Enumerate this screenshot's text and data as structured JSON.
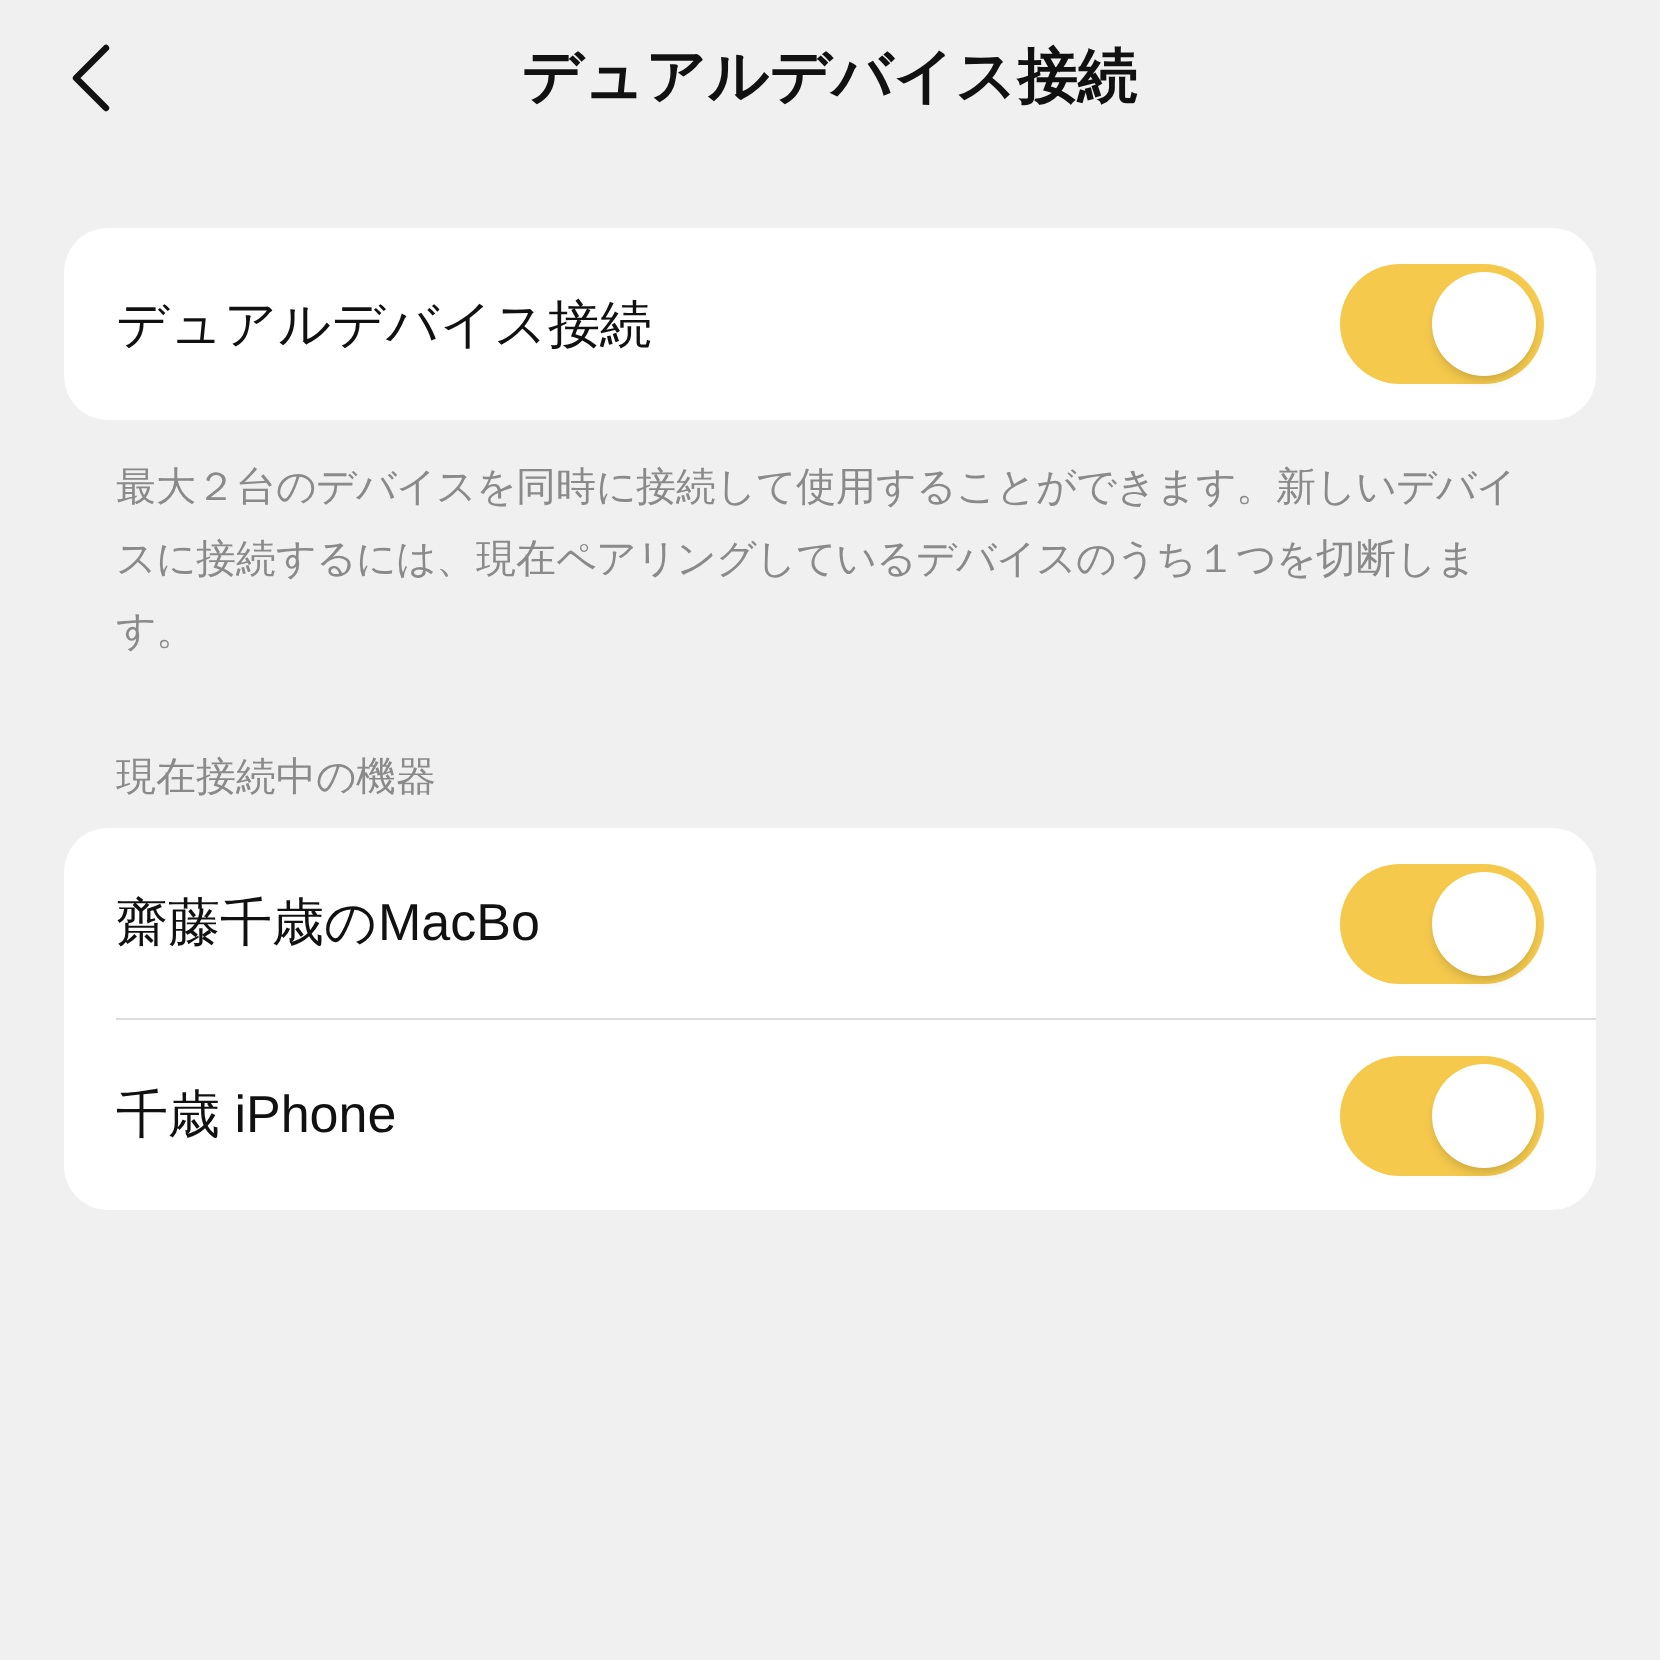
{
  "header": {
    "title": "デュアルデバイス接続"
  },
  "main_setting": {
    "label": "デュアルデバイス接続",
    "on": true
  },
  "description": "最大２台のデバイスを同時に接続して使用することができます。新しいデバイスに接続するには、現在ペアリングしているデバイスのうち１つを切断します。",
  "section_title": "現在接続中の機器",
  "devices": [
    {
      "name": "齋藤千歳のMacBo",
      "on": true
    },
    {
      "name": "千歳 iPhone",
      "on": true
    }
  ]
}
